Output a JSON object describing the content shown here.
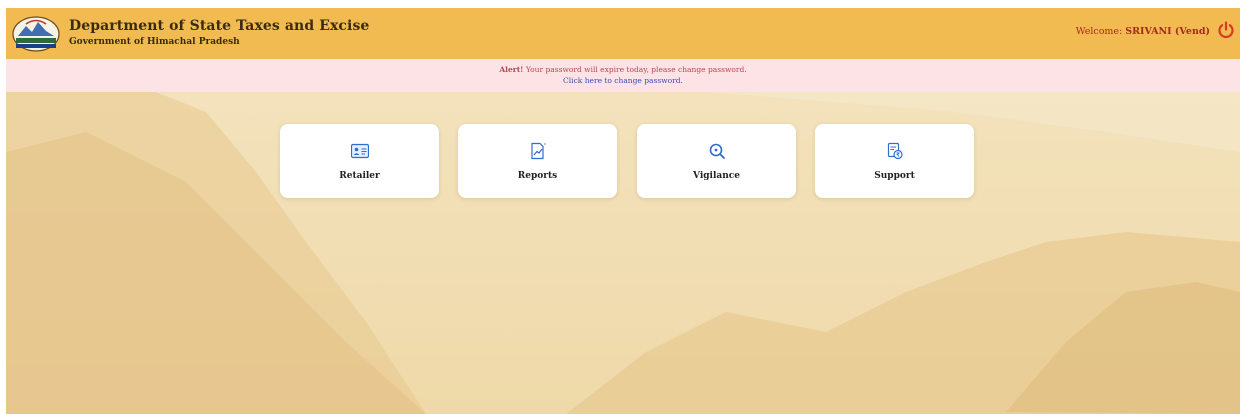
{
  "header": {
    "title": "Department of State Taxes and Excise",
    "subtitle": "Government of Himachal Pradesh",
    "welcome_prefix": "Welcome: ",
    "welcome_user": "SRIVANI (Vend)",
    "logo_icon": "himachal-emblem-icon",
    "power_icon": "power-icon",
    "bar_color": "#f2bb52"
  },
  "alert": {
    "label": "Alert!",
    "message": " Your password will expire today, please change password.",
    "link": "Click here to change password.",
    "bg_color": "#fde3e6"
  },
  "cards": [
    {
      "label": "Retailer",
      "icon": "id-card-icon"
    },
    {
      "label": "Reports",
      "icon": "report-chart-icon"
    },
    {
      "label": "Vigilance",
      "icon": "magnifier-icon"
    },
    {
      "label": "Support",
      "icon": "support-rupee-doc-icon"
    }
  ],
  "colors": {
    "accent_blue": "#2f6dd0",
    "background_tint": "#efd7a4"
  }
}
